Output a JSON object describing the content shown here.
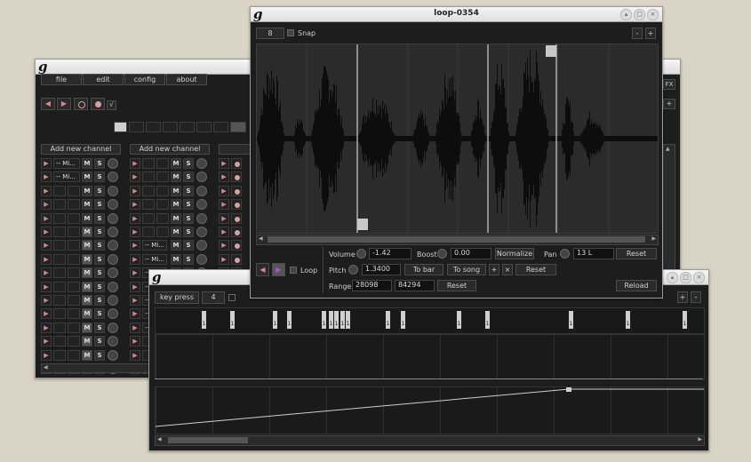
{
  "main_window": {
    "menu": [
      "file",
      "edit",
      "config",
      "about"
    ],
    "add_channel_label": "Add new channel",
    "channel_names": [
      "-- Mi...",
      "-- Mi..."
    ],
    "mute_label": "M",
    "solo_label": "S",
    "col2_names": [
      "-- Mi...",
      "-- Mi...",
      "-- Mi...",
      "-- Mi...",
      "-- Mi...",
      "-- Mi...",
      "-- Mi..."
    ],
    "fx_label": "FX",
    "plus_label": "+"
  },
  "loop_window": {
    "title": "loop-0354",
    "grid_value": "8",
    "snap_label": "Snap",
    "zoom_out": "-",
    "zoom_in": "+",
    "loop_label": "Loop",
    "volume_label": "Volume",
    "volume_value": "-1.42",
    "boost_label": "Boost",
    "boost_value": "0.00",
    "normalize_label": "Normalize",
    "pan_label": "Pan",
    "pan_value": "13 L",
    "reset_label": "Reset",
    "pitch_label": "Pitch",
    "pitch_value": "1.3400",
    "to_bar_label": "To bar",
    "to_song_label": "To song",
    "plus": "+",
    "cross": "×",
    "range_label": "Range",
    "range_start": "28098",
    "range_end": "84294",
    "reload_label": "Reload"
  },
  "action_window": {
    "key_press_label": "key press",
    "bar_value": "4",
    "plus": "+",
    "minus": "-",
    "action_marker": "1"
  }
}
